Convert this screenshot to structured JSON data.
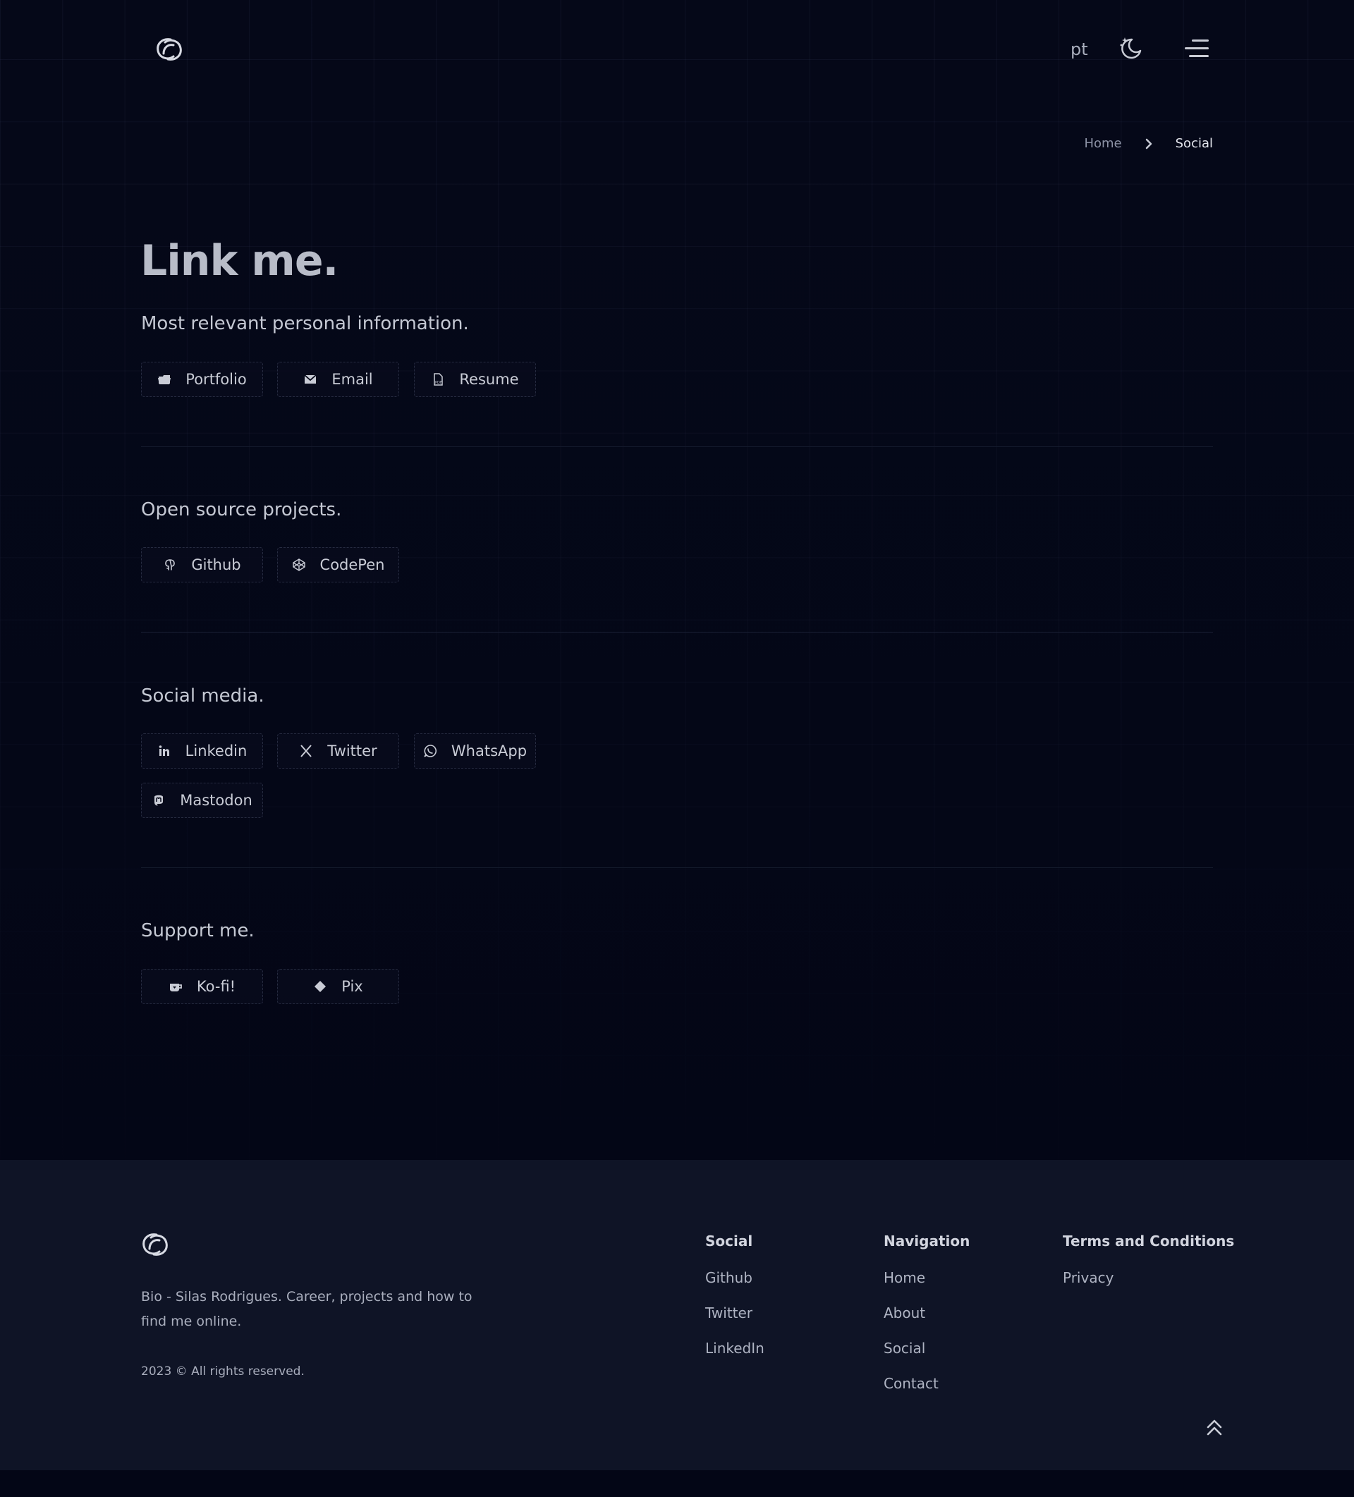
{
  "header": {
    "logo_icon": "double-loop-logo-icon",
    "lang": "pt",
    "theme_icon": "moon-stars-icon",
    "menu_icon": "hamburger-menu-icon"
  },
  "breadcrumb": {
    "home": "Home",
    "separator_icon": "chevron-right-icon",
    "current": "Social"
  },
  "main": {
    "title": "Link me.",
    "sections": [
      {
        "title": "Most relevant personal information.",
        "links": [
          {
            "label": "Portfolio",
            "icon": "folder-icon"
          },
          {
            "label": "Email",
            "icon": "envelope-icon"
          },
          {
            "label": "Resume",
            "icon": "pdf-file-icon"
          }
        ]
      },
      {
        "title": "Open source projects.",
        "links": [
          {
            "label": "Github",
            "icon": "github-icon"
          },
          {
            "label": "CodePen",
            "icon": "codepen-icon"
          }
        ]
      },
      {
        "title": "Social media.",
        "links": [
          {
            "label": "Linkedin",
            "icon": "linkedin-icon"
          },
          {
            "label": "Twitter",
            "icon": "x-icon"
          },
          {
            "label": "WhatsApp",
            "icon": "whatsapp-icon"
          },
          {
            "label": "Mastodon",
            "icon": "mastodon-icon"
          }
        ]
      },
      {
        "title": "Support me.",
        "links": [
          {
            "label": "Ko-fi!",
            "icon": "kofi-cup-icon"
          },
          {
            "label": "Pix",
            "icon": "pix-icon"
          }
        ]
      }
    ]
  },
  "footer": {
    "logo_icon": "double-loop-logo-icon",
    "description": "Bio - Silas Rodrigues. Career, projects and how to find me online.",
    "copyright": "2023 © All rights reserved.",
    "columns": [
      {
        "title": "Social",
        "links": [
          "Github",
          "Twitter",
          "LinkedIn"
        ]
      },
      {
        "title": "Navigation",
        "links": [
          "Home",
          "About",
          "Social",
          "Contact"
        ]
      },
      {
        "title": "Terms and Conditions",
        "links": [
          "Privacy"
        ]
      }
    ],
    "back_to_top_icon": "double-chevron-up-icon"
  },
  "colors": {
    "background": "#030616",
    "footer_background": "#0f1426",
    "text": "#c9ccd6",
    "muted_text": "#8d93a6",
    "button_border": "#262b40"
  }
}
